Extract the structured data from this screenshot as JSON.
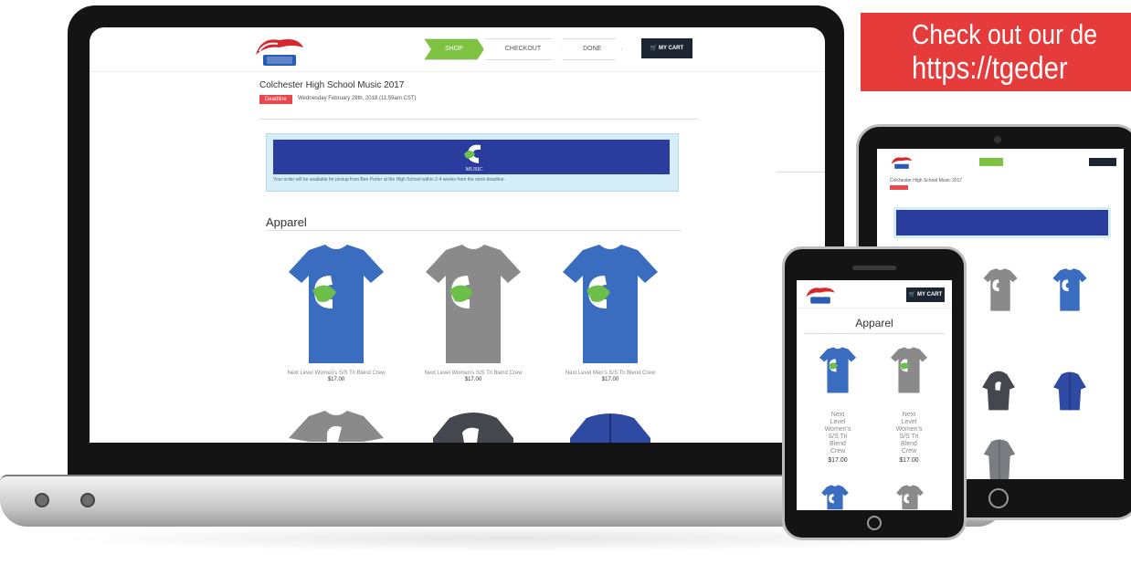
{
  "promo": {
    "line1": "Check out our de",
    "line2": "https://tgeder"
  },
  "header": {
    "steps": [
      "SHOP",
      "CHECKOUT",
      "DONE"
    ],
    "cart_label": "MY CART"
  },
  "store": {
    "title": "Colchester High School Music 2017",
    "deadline_label": "Deadline",
    "deadline_value": "Wednesday February 28th, 2018 (11:59am CST)"
  },
  "notice": {
    "banner_text": "MUSIC",
    "text": "Your order will be available for pickup from Ben Porter at the High School within 2-4 weeks from the store deadline."
  },
  "section": {
    "title": "Apparel"
  },
  "products": [
    {
      "name": "Next Level Women's S/S Tri Blend Crew",
      "price": "$17.00",
      "color": "#3a6cc0"
    },
    {
      "name": "Next Level Women's S/S Tri Blend Crew",
      "price": "$17.00",
      "color": "#8a8a8a"
    },
    {
      "name": "Next Level Men's S/S Tri Blend Crew",
      "price": "$17.00",
      "color": "#3a6cc0"
    }
  ],
  "phone": {
    "cart_label": "MY CART",
    "section_title": "Apparel",
    "product_name_lines": [
      "Next",
      "Level",
      "Women's",
      "S/S Tri",
      "Blend",
      "Crew"
    ],
    "price": "$17.00"
  },
  "colors": {
    "accent_green": "#7ec242",
    "cart_dark": "#1e2532",
    "deadline_red": "#e8474b",
    "banner_blue": "#2a3d9e",
    "promo_red": "#e53b3a"
  }
}
